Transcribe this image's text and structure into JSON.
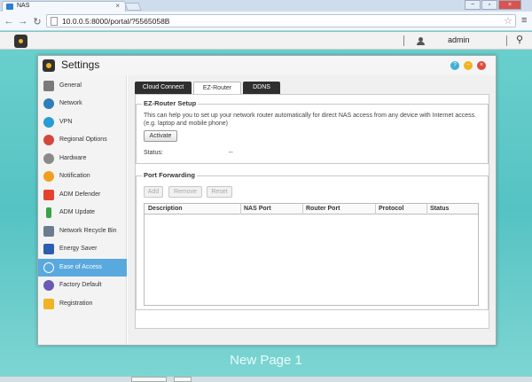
{
  "browser": {
    "tab_title": "NAS",
    "url": "10.0.0.5:8000/portal/?5565058B",
    "controls": {
      "minimize": "−",
      "restore": "▫",
      "close": "×"
    }
  },
  "adm_bar": {
    "username": "admin"
  },
  "window": {
    "title": "Settings",
    "controls": {
      "help": "?",
      "minimize": "−",
      "close": "×"
    }
  },
  "sidebar": {
    "items": [
      {
        "label": "General",
        "icon": "general-icon",
        "color": "#7a7a7a"
      },
      {
        "label": "Network",
        "icon": "globe-icon",
        "color": "#2e7fb9"
      },
      {
        "label": "VPN",
        "icon": "vpn-icon",
        "color": "#2b9bd1"
      },
      {
        "label": "Regional Options",
        "icon": "regional-icon",
        "color": "#d4463b"
      },
      {
        "label": "Hardware",
        "icon": "hardware-icon",
        "color": "#8a8a8a"
      },
      {
        "label": "Notification",
        "icon": "notification-icon",
        "color": "#f0a020"
      },
      {
        "label": "ADM Defender",
        "icon": "shield-icon",
        "color": "#e3422f"
      },
      {
        "label": "ADM Update",
        "icon": "update-icon",
        "color": "#3aa345"
      },
      {
        "label": "Network Recycle Bin",
        "icon": "recycle-bin-icon",
        "color": "#6a7d8e"
      },
      {
        "label": "Energy Saver",
        "icon": "energy-icon",
        "color": "#2a5fb0"
      },
      {
        "label": "Ease of Access",
        "icon": "cloud-icon",
        "color": "#ffffff"
      },
      {
        "label": "Factory Default",
        "icon": "undo-icon",
        "color": "#6a5ab5"
      },
      {
        "label": "Registration",
        "icon": "registration-icon",
        "color": "#f0b323"
      }
    ],
    "active_index": 10
  },
  "tabs": [
    {
      "label": "Cloud Connect"
    },
    {
      "label": "EZ-Router"
    },
    {
      "label": "DDNS"
    }
  ],
  "active_tab": "EZ-Router",
  "ez_router": {
    "legend": "EZ-Router Setup",
    "description": "This can help you to set up your network router automatically for direct NAS access from any device with Internet access. (e.g. laptop and mobile phone)",
    "activate_label": "Activate",
    "status_label": "Status:",
    "status_value": "--"
  },
  "port_forwarding": {
    "legend": "Port Forwarding",
    "buttons": {
      "add": "Add",
      "remove": "Remove",
      "reset": "Reset"
    },
    "columns": [
      "Description",
      "NAS Port",
      "Router Port",
      "Protocol",
      "Status"
    ]
  },
  "footer": {
    "page_label": "New Page 1"
  }
}
